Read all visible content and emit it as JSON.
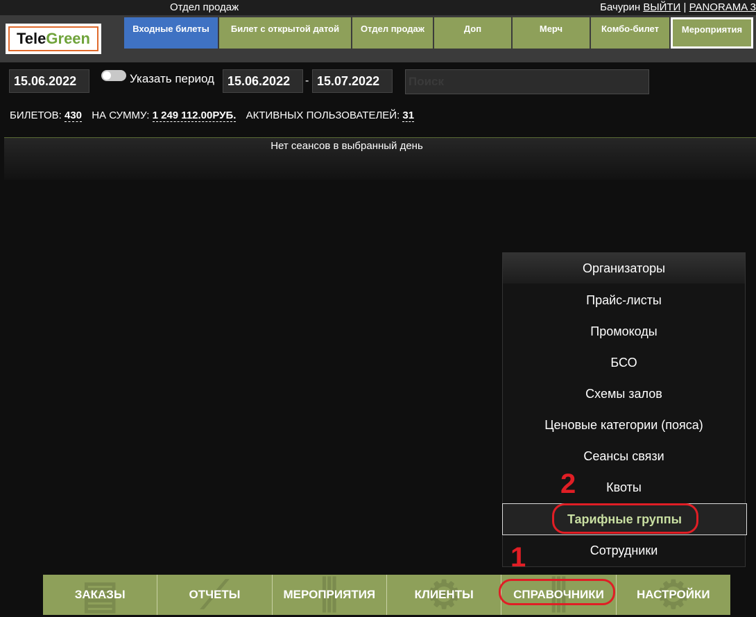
{
  "top": {
    "dept_title": "Отдел продаж",
    "user_name": "Бачурин",
    "logout": "ВЫЙТИ",
    "sep": "|",
    "org": "PANORAMA 3"
  },
  "logo": {
    "part1": "Tele",
    "part2": "Green"
  },
  "tabs": [
    "Входные билеты",
    "Билет с открытой датой",
    "Отдел продаж",
    "Доп",
    "Мерч",
    "Комбо-билет",
    "Мероприятия"
  ],
  "filters": {
    "date": "15.06.2022",
    "period_label": "Указать период",
    "date_from": "15.06.2022",
    "dash": "-",
    "date_to": "15.07.2022",
    "search_placeholder": "Поиск"
  },
  "stats": {
    "tickets_label": "БИЛЕТОВ:",
    "tickets_value": "430",
    "sum_label": "НА СУММУ:",
    "sum_value": "1 249 112.00РУБ.",
    "users_label": "АКТИВНЫХ ПОЛЬЗОВАТЕЛЕЙ:",
    "users_value": "31"
  },
  "main": {
    "no_sessions": "Нет сеансов в выбранный день"
  },
  "dropdown": [
    "Организаторы",
    "Прайс-листы",
    "Промокоды",
    "БСО",
    "Схемы залов",
    "Ценовые категории (пояса)",
    "Сеансы связи",
    "Квоты",
    "Тарифные группы",
    "Сотрудники"
  ],
  "bottom_nav": [
    "ЗАКАЗЫ",
    "ОТЧЕТЫ",
    "МЕРОПРИЯТИЯ",
    "КЛИЕНТЫ",
    "СПРАВОЧНИКИ",
    "НАСТРОЙКИ"
  ],
  "annotations": {
    "step1": "1",
    "step2": "2"
  },
  "colors": {
    "tab_green": "#8ea05a",
    "tab_blue": "#3f72c3",
    "annotation_red": "#e01e25",
    "active_text": "#c9dfa2"
  }
}
